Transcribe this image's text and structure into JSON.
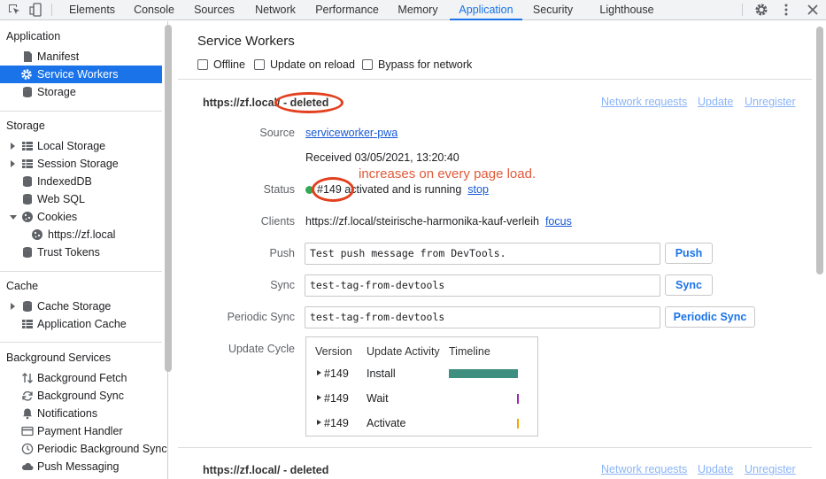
{
  "tabs": [
    "Elements",
    "Console",
    "Sources",
    "Network",
    "Performance",
    "Memory",
    "Application",
    "Security",
    "Lighthouse"
  ],
  "active_tab": "Application",
  "sidebar": {
    "sections": [
      {
        "title": "Application",
        "items": [
          {
            "label": "Manifest",
            "icon": "file-icon"
          },
          {
            "label": "Service Workers",
            "icon": "gear-icon",
            "selected": true
          },
          {
            "label": "Storage",
            "icon": "database-icon"
          }
        ]
      },
      {
        "title": "Storage",
        "items": [
          {
            "label": "Local Storage",
            "icon": "grid-icon"
          },
          {
            "label": "Session Storage",
            "icon": "grid-icon"
          },
          {
            "label": "IndexedDB",
            "icon": "database-icon"
          },
          {
            "label": "Web SQL",
            "icon": "database-icon"
          },
          {
            "label": "Cookies",
            "icon": "cookie-icon"
          },
          {
            "label": "https://zf.local",
            "icon": "cookie-icon"
          },
          {
            "label": "Trust Tokens",
            "icon": "database-icon"
          }
        ]
      },
      {
        "title": "Cache",
        "items": [
          {
            "label": "Cache Storage",
            "icon": "database-icon"
          },
          {
            "label": "Application Cache",
            "icon": "grid-icon"
          }
        ]
      },
      {
        "title": "Background Services",
        "items": [
          {
            "label": "Background Fetch",
            "icon": "arrows-updown-icon"
          },
          {
            "label": "Background Sync",
            "icon": "sync-icon"
          },
          {
            "label": "Notifications",
            "icon": "bell-icon"
          },
          {
            "label": "Payment Handler",
            "icon": "card-icon"
          },
          {
            "label": "Periodic Background Sync",
            "icon": "clock-icon"
          },
          {
            "label": "Push Messaging",
            "icon": "cloud-icon"
          }
        ]
      }
    ]
  },
  "main": {
    "title": "Service Workers",
    "checkboxes": [
      "Offline",
      "Update on reload",
      "Bypass for network"
    ],
    "worker": {
      "origin": "https://zf.local/",
      "deleted": " - deleted",
      "links": [
        "Network requests",
        "Update",
        "Unregister"
      ],
      "source_label": "Source",
      "source_link": "serviceworker-pwa",
      "received": "Received 03/05/2021, 13:20:40",
      "annotation": "increases on every page load.",
      "status_label": "Status",
      "status_id": "#149",
      "status_text": " activated and is running",
      "status_link": "stop",
      "clients_label": "Clients",
      "clients_value": "https://zf.local/steirische-harmonika-kauf-verleih",
      "clients_link": "focus",
      "push_label": "Push",
      "push_value": "Test push message from DevTools.",
      "push_button": "Push",
      "sync_label": "Sync",
      "sync_value": "test-tag-from-devtools",
      "sync_button": "Sync",
      "psync_label": "Periodic Sync",
      "psync_value": "test-tag-from-devtools",
      "psync_button": "Periodic Sync",
      "cycle_label": "Update Cycle",
      "cycle": {
        "headers": [
          "Version",
          "Update Activity",
          "Timeline"
        ],
        "rows": [
          {
            "version": "#149",
            "activity": "Install",
            "timeline_start": 0.0,
            "timeline_end": 1.0
          },
          {
            "version": "#149",
            "activity": "Wait",
            "timeline_start": 0.99,
            "timeline_end": 1.0
          },
          {
            "version": "#149",
            "activity": "Activate",
            "timeline_start": 0.99,
            "timeline_end": 1.0
          }
        ]
      }
    },
    "worker2": {
      "origin": "https://zf.local/",
      "deleted": " - deleted",
      "links": [
        "Network requests",
        "Update",
        "Unregister"
      ]
    }
  },
  "colors": {
    "accent": "#1a73e8",
    "annotation": "#e2401e",
    "timeline": "#3d8f7f"
  }
}
